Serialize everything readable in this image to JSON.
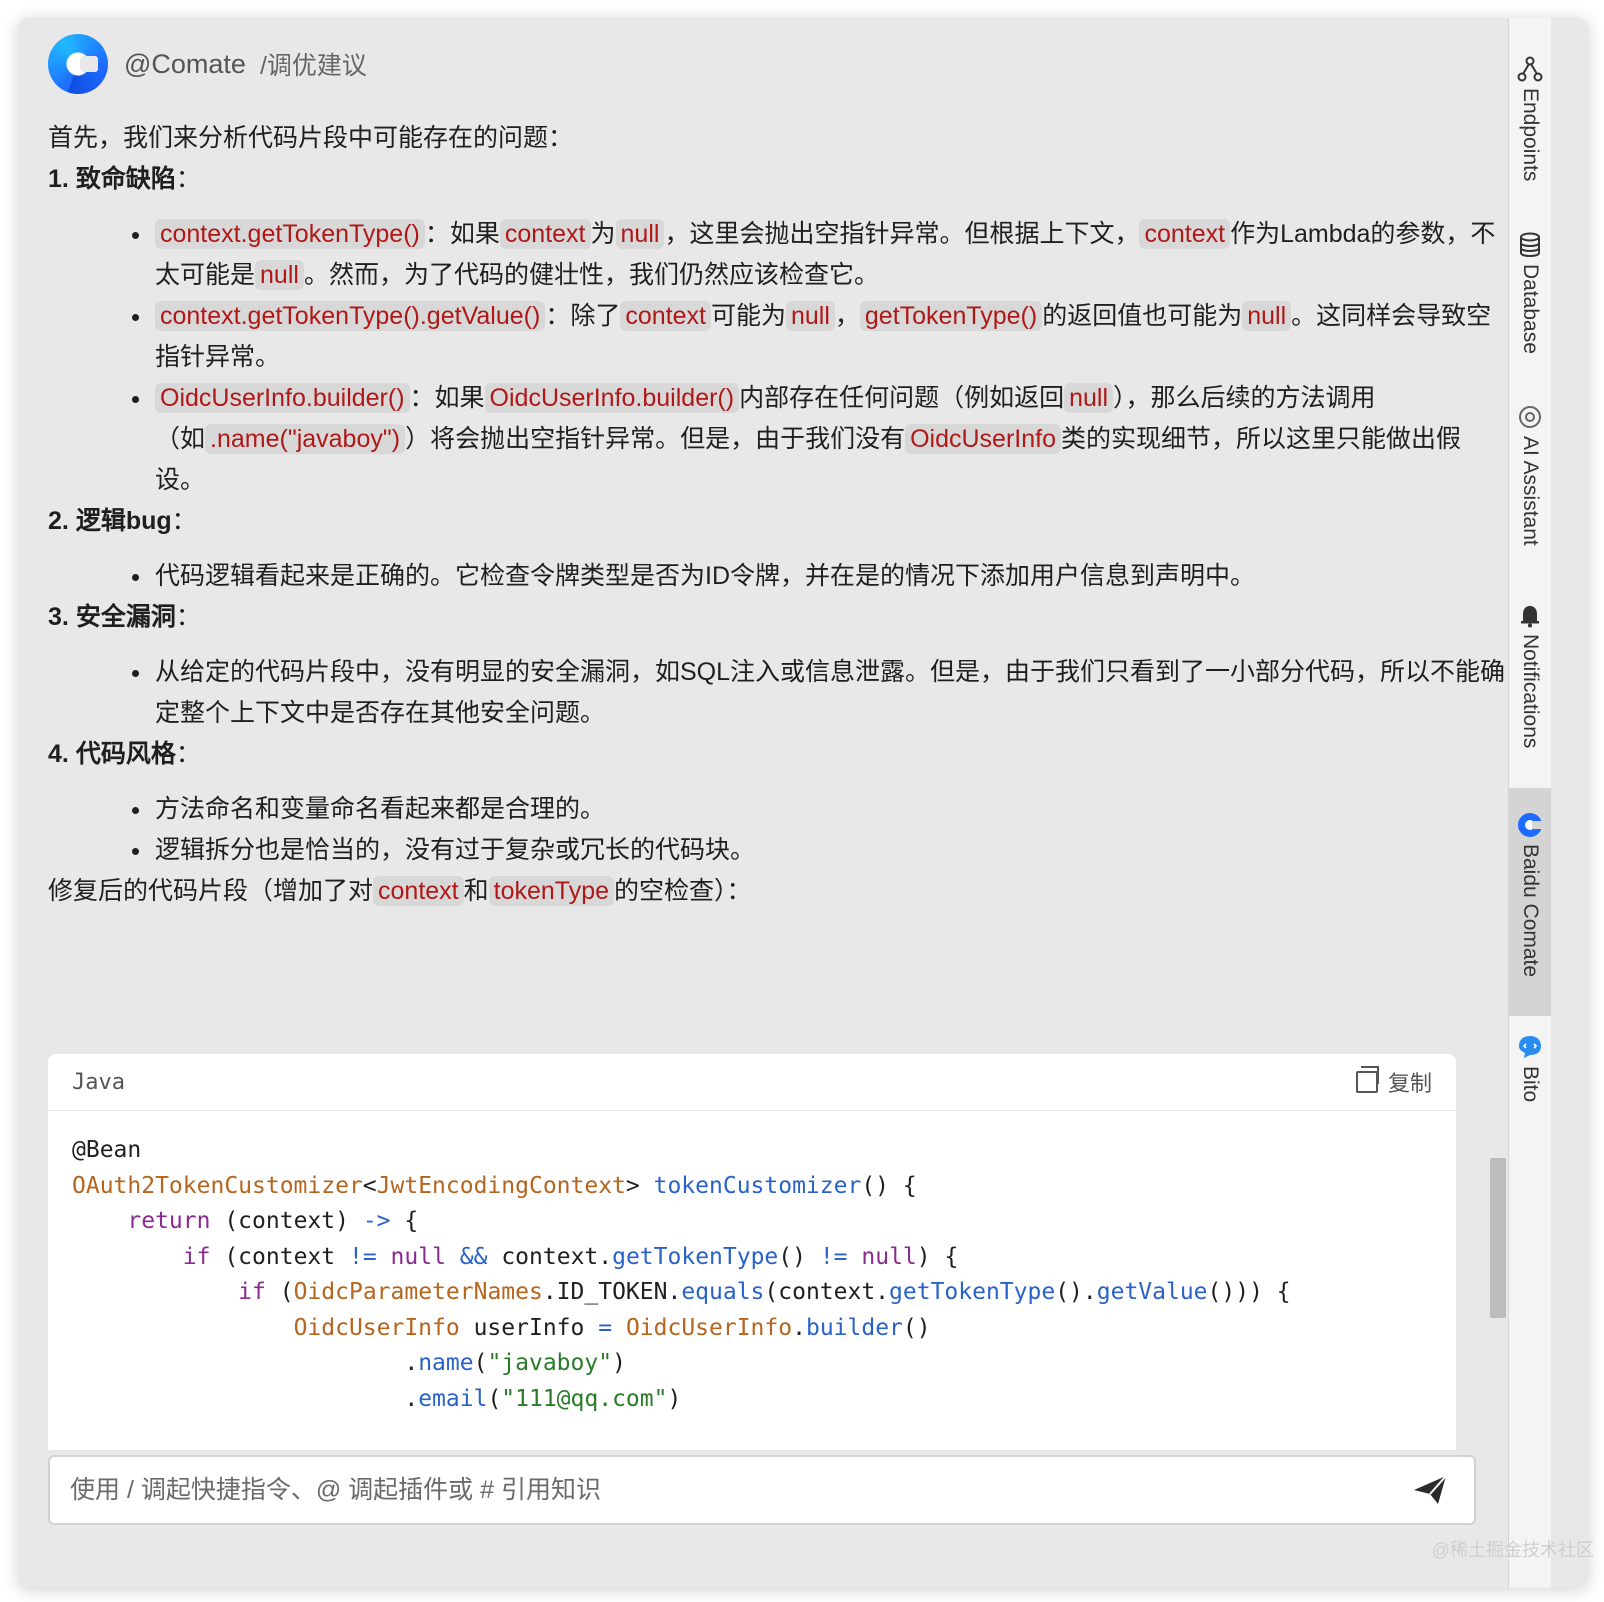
{
  "header": {
    "mention": "@Comate",
    "command": "/调优建议"
  },
  "intro": "首先，我们来分析代码片段中可能存在的问题：",
  "sections": [
    {
      "num": "1.",
      "title": "致命缺陷",
      "colon": "："
    },
    {
      "num": "2.",
      "title": "逻辑bug",
      "colon": "："
    },
    {
      "num": "3.",
      "title": "安全漏洞",
      "colon": "："
    },
    {
      "num": "4.",
      "title": "代码风格",
      "colon": "："
    }
  ],
  "s1": {
    "b1": {
      "c1": "context.getTokenType()",
      "t1": "：如果",
      "c2": "context",
      "t2": "为",
      "c3": "null",
      "t3": "，这里会抛出空指针异常。但根据上下文，",
      "c4": "context",
      "t4": "作为Lambda的参数，不太可能是",
      "c5": "null",
      "t5": "。然而，为了代码的健壮性，我们仍然应该检查它。"
    },
    "b2": {
      "c1": "context.getTokenType().getValue()",
      "t1": "：除了",
      "c2": "context",
      "t2": "可能为",
      "c3": "null",
      "t3": "，",
      "c4": "getTokenType()",
      "t4": "的返回值也可能为",
      "c5": "null",
      "t5": "。这同样会导致空指针异常。"
    },
    "b3": {
      "c1": "OidcUserInfo.builder()",
      "t1": "：如果",
      "c2": "OidcUserInfo.builder()",
      "t2": "内部存在任何问题（例如返回",
      "c3": "null",
      "t3": "），那么后续的方法调用（如",
      "c4": ".name(\"javaboy\")",
      "t4": "）将会抛出空指针异常。但是，由于我们没有",
      "c5": "OidcUserInfo",
      "t5": "类的实现细节，所以这里只能做出假设。"
    }
  },
  "s2": {
    "b1": "代码逻辑看起来是正确的。它检查令牌类型是否为ID令牌，并在是的情况下添加用户信息到声明中。"
  },
  "s3": {
    "b1": "从给定的代码片段中，没有明显的安全漏洞，如SQL注入或信息泄露。但是，由于我们只看到了一小部分代码，所以不能确定整个上下文中是否存在其他安全问题。"
  },
  "s4": {
    "b1": "方法命名和变量命名看起来都是合理的。",
    "b2": "逻辑拆分也是恰当的，没有过于复杂或冗长的代码块。"
  },
  "fix": {
    "t1": "修复后的代码片段（增加了对",
    "c1": "context",
    "t2": "和",
    "c2": "tokenType",
    "t3": "的空检查）："
  },
  "code": {
    "lang": "Java",
    "copy_label": "复制",
    "lines": {
      "l1": "@Bean",
      "l2a": "OAuth2TokenCustomizer",
      "l2b": "<",
      "l2c": "JwtEncodingContext",
      "l2d": "> ",
      "l2e": "tokenCustomizer",
      "l2f": "() {",
      "l3a": "    ",
      "l3b": "return",
      "l3c": " (context) ",
      "l3d": "->",
      "l3e": " {",
      "l4a": "        ",
      "l4b": "if",
      "l4c": " (context ",
      "l4d": "!=",
      "l4e": " ",
      "l4f": "null",
      "l4g": " ",
      "l4h": "&&",
      "l4i": " context.",
      "l4j": "getTokenType",
      "l4k": "() ",
      "l4l": "!=",
      "l4m": " ",
      "l4n": "null",
      "l4o": ") {",
      "l5a": "            ",
      "l5b": "if",
      "l5c": " (",
      "l5d": "OidcParameterNames",
      "l5e": ".ID_TOKEN.",
      "l5f": "equals",
      "l5g": "(context.",
      "l5h": "getTokenType",
      "l5i": "().",
      "l5j": "getValue",
      "l5k": "())) {",
      "l6a": "                ",
      "l6b": "OidcUserInfo",
      "l6c": " userInfo ",
      "l6d": "=",
      "l6e": " ",
      "l6f": "OidcUserInfo",
      "l6g": ".",
      "l6h": "builder",
      "l6i": "()",
      "l7a": "                        .",
      "l7b": "name",
      "l7c": "(",
      "l7d": "\"javaboy\"",
      "l7e": ")",
      "l8a": "                        .",
      "l8b": "email",
      "l8c": "(",
      "l8d": "\"111@qq.com\"",
      "l8e": ")"
    }
  },
  "input": {
    "placeholder": "使用 / 调起快捷指令、@ 调起插件或 # 引用知识"
  },
  "sidebar": {
    "items": [
      {
        "label": "Endpoints",
        "icon": "endpoints-icon"
      },
      {
        "label": "Database",
        "icon": "database-icon"
      },
      {
        "label": "AI Assistant",
        "icon": "ai-assistant-icon"
      },
      {
        "label": "Notifications",
        "icon": "bell-icon"
      },
      {
        "label": "Baidu Comate",
        "icon": "comate-icon",
        "active": true
      },
      {
        "label": "Bito",
        "icon": "bito-icon"
      }
    ]
  },
  "watermark": "@稀土掘金技术社区",
  "colors": {
    "inline_code": "#b01818",
    "keyword": "#8a2c8f",
    "class": "#b5651d",
    "function": "#2962c8",
    "string": "#2a7a2a"
  }
}
